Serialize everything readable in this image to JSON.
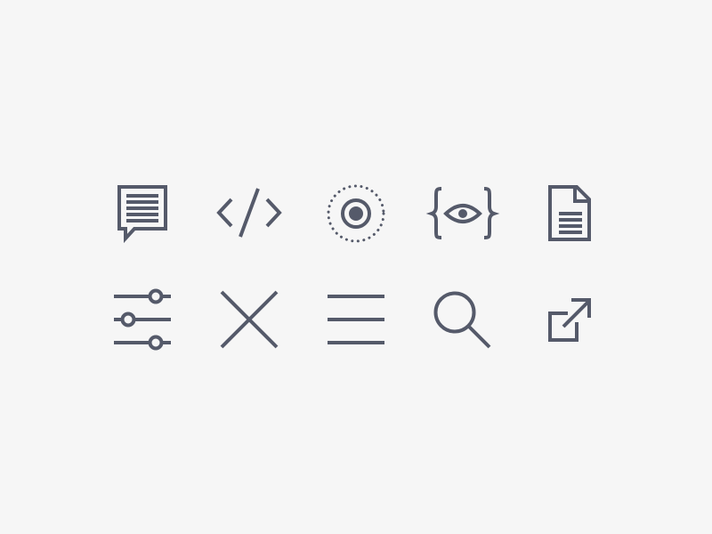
{
  "colors": {
    "background": "#f6f6f6",
    "icon": "#555a6a"
  },
  "icons": [
    {
      "name": "chat-bubble-icon"
    },
    {
      "name": "code-icon"
    },
    {
      "name": "radio-target-icon"
    },
    {
      "name": "eye-braces-icon"
    },
    {
      "name": "document-icon"
    },
    {
      "name": "sliders-icon"
    },
    {
      "name": "close-icon"
    },
    {
      "name": "menu-icon"
    },
    {
      "name": "search-icon"
    },
    {
      "name": "external-link-icon"
    }
  ]
}
